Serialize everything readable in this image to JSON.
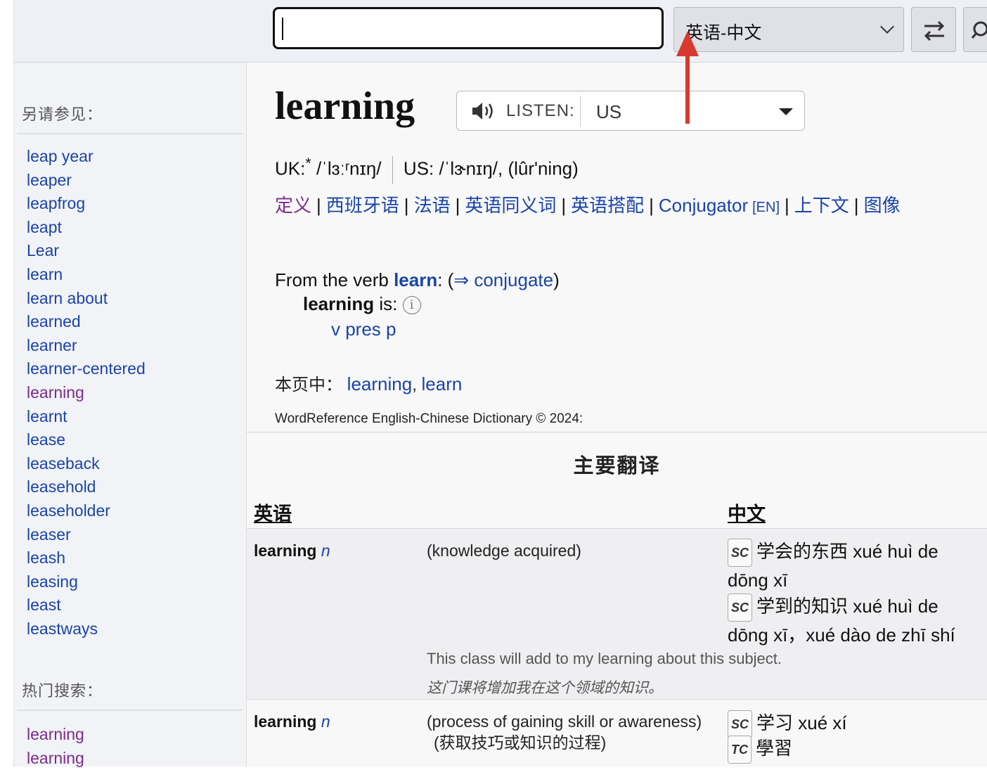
{
  "header": {
    "search_value": "",
    "language_selected": "英语-中文"
  },
  "sidebar": {
    "see_also_heading": "另请参见：",
    "see_also": [
      {
        "label": "leap year",
        "visited": false
      },
      {
        "label": "leaper",
        "visited": false
      },
      {
        "label": "leapfrog",
        "visited": false
      },
      {
        "label": "leapt",
        "visited": false
      },
      {
        "label": "Lear",
        "visited": false
      },
      {
        "label": "learn",
        "visited": false
      },
      {
        "label": "learn about",
        "visited": false
      },
      {
        "label": "learned",
        "visited": false
      },
      {
        "label": "learner",
        "visited": false
      },
      {
        "label": "learner-centered",
        "visited": false
      },
      {
        "label": "learning",
        "visited": true
      },
      {
        "label": "learnt",
        "visited": false
      },
      {
        "label": "lease",
        "visited": false
      },
      {
        "label": "leaseback",
        "visited": false
      },
      {
        "label": "leasehold",
        "visited": false
      },
      {
        "label": "leaseholder",
        "visited": false
      },
      {
        "label": "leaser",
        "visited": false
      },
      {
        "label": "leash",
        "visited": false
      },
      {
        "label": "leasing",
        "visited": false
      },
      {
        "label": "least",
        "visited": false
      },
      {
        "label": "leastways",
        "visited": false
      }
    ],
    "popular_heading": "热门搜索：",
    "popular": [
      {
        "label": "learning",
        "visited": true
      },
      {
        "label": "learning",
        "visited": true
      }
    ]
  },
  "entry": {
    "headword": "learning",
    "listen_label": "LISTEN:",
    "listen_accent": "US",
    "uk_label": "UK:",
    "uk_star": "*",
    "uk_ipa": "/ˈlɜːʳnɪŋ/",
    "us_label": "US:",
    "us_ipa": "/ˈlɝnɪŋ/",
    "us_resp": "(lûrʹning)",
    "nav": [
      {
        "label": "定义",
        "visited": true
      },
      {
        "label": "西班牙语",
        "visited": false
      },
      {
        "label": "法语",
        "visited": false
      },
      {
        "label": "英语同义词",
        "visited": false
      },
      {
        "label": "英语搭配",
        "visited": false
      },
      {
        "label": "Conjugator",
        "suffix": "[EN]",
        "visited": false
      },
      {
        "label": "上下文",
        "visited": false
      },
      {
        "label": "图像",
        "visited": false
      }
    ],
    "from_verb_prefix": "From the verb ",
    "from_verb_word": "learn",
    "from_verb_mid": ": (",
    "conjugate_link": "⇒ conjugate",
    "from_verb_suffix": ")",
    "form_word": "learning",
    "form_is": " is: ",
    "info_glyph": "i",
    "form_value": "v pres p",
    "on_page_label": "本页中：",
    "on_page_links": [
      "learning",
      "learn"
    ],
    "copyright": "WordReference English-Chinese Dictionary © 2024:"
  },
  "table": {
    "title": "主要翻译",
    "col_en": "英语",
    "col_zh": "中文",
    "rows": [
      {
        "term": "learning",
        "pos": "n",
        "gloss": "(knowledge acquired)",
        "translations": [
          {
            "badge": "SC",
            "text": "学会的东西 xué huì de dōng xī"
          },
          {
            "badge": "SC",
            "text": "学到的知识 xué huì de dōng xī，xué dào de zhī shí"
          }
        ],
        "example_en": "This class will add to my learning about this subject.",
        "example_zh": "这门课将增加我在这个领域的知识。"
      },
      {
        "term": "learning",
        "pos": "n",
        "gloss": "(process of gaining skill or awareness)",
        "gloss_zh": "(获取技巧或知识的过程)",
        "translations": [
          {
            "badge": "SC",
            "text": "学习 xué xí"
          },
          {
            "badge": "TC",
            "text": "學習"
          }
        ]
      }
    ]
  },
  "colors": {
    "link": "#1a44a8",
    "visited": "#7b2c8a",
    "arrow": "#d63a2f"
  }
}
